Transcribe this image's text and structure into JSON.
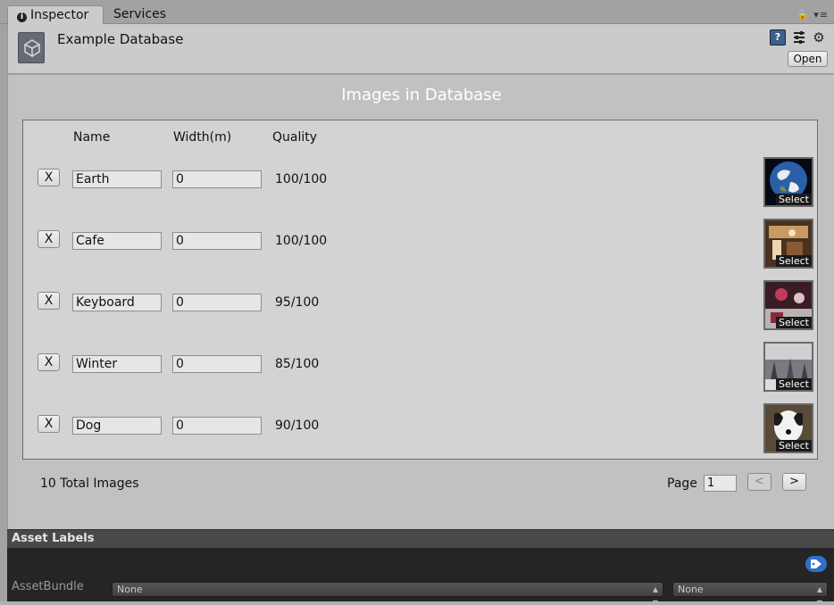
{
  "tabs": [
    {
      "label": "Inspector",
      "active": true
    },
    {
      "label": "Services",
      "active": false
    }
  ],
  "tab_tools": "🔒 ▾≡",
  "header": {
    "title": "Example Database",
    "help_glyph": "?",
    "gear_glyph": "⚙",
    "open_label": "Open"
  },
  "db": {
    "title": "Images in Database",
    "columns": [
      "Name",
      "Width(m)",
      "Quality"
    ],
    "remove_label": "X",
    "select_label": "Select",
    "rows": [
      {
        "name": "Earth",
        "width": "0",
        "quality": "100/100",
        "thumb_color": "#1d3f7a"
      },
      {
        "name": "Cafe",
        "width": "0",
        "quality": "100/100",
        "thumb_color": "#6b4a2e"
      },
      {
        "name": "Keyboard",
        "width": "0",
        "quality": "95/100",
        "thumb_color": "#6a2a3a"
      },
      {
        "name": "Winter",
        "width": "0",
        "quality": "85/100",
        "thumb_color": "#8c8c90"
      },
      {
        "name": "Dog",
        "width": "0",
        "quality": "90/100",
        "thumb_color": "#3b3a36"
      }
    ],
    "total": "10 Total Images",
    "page_label": "Page",
    "page_value": "1",
    "prev_label": "<",
    "next_label": ">"
  },
  "asset_labels": {
    "title": "Asset Labels",
    "assetbundle_label": "AssetBundle",
    "bundle_value": "None",
    "variant_value": "None"
  }
}
